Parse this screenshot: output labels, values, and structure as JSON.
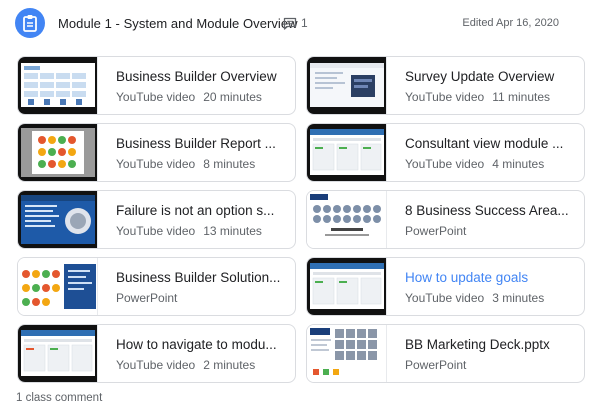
{
  "header": {
    "title": "Module 1 - System and Module Overview",
    "comment_count": "1",
    "edited": "Edited Apr 16, 2020"
  },
  "materials": [
    {
      "title": "Business Builder Overview",
      "type": "YouTube video",
      "duration": "20 minutes",
      "thumb": "spreadsheet"
    },
    {
      "title": "Survey Update Overview",
      "type": "YouTube video",
      "duration": "11 minutes",
      "thumb": "form"
    },
    {
      "title": "Business Builder Report ...",
      "type": "YouTube video",
      "duration": "8 minutes",
      "thumb": "gauges"
    },
    {
      "title": "Consultant view module ...",
      "type": "YouTube video",
      "duration": "4 minutes",
      "thumb": "dashboard"
    },
    {
      "title": "Failure is not an option s...",
      "type": "YouTube video",
      "duration": "13 minutes",
      "thumb": "slide-blue"
    },
    {
      "title": "8 Business Success Area...",
      "type": "PowerPoint",
      "duration": "",
      "thumb": "faces"
    },
    {
      "title": "Business Builder Solution...",
      "type": "PowerPoint",
      "duration": "",
      "thumb": "gauges-slide"
    },
    {
      "title": "How to update goals",
      "type": "YouTube video",
      "duration": "3 minutes",
      "thumb": "dashboard"
    },
    {
      "title": "How to navigate to modu...",
      "type": "YouTube video",
      "duration": "2 minutes",
      "thumb": "dashboard"
    },
    {
      "title": "BB Marketing Deck.pptx",
      "type": "PowerPoint",
      "duration": "",
      "thumb": "faces-grid"
    }
  ],
  "footer": {
    "comments": "1 class comment"
  },
  "colors": {
    "accent": "#4285f4",
    "link": "#4285f4",
    "border": "#dadce0"
  }
}
